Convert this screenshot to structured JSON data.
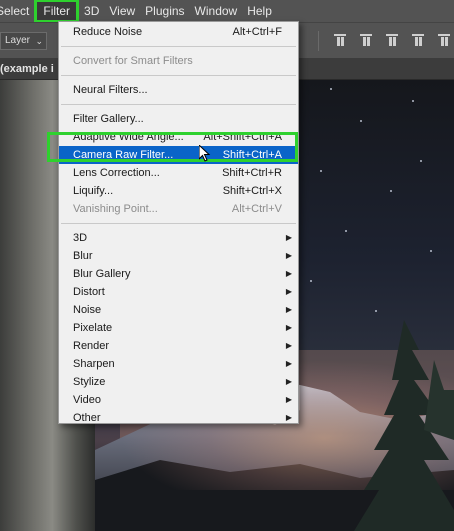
{
  "menubar": {
    "items": [
      "Select",
      "Filter",
      "3D",
      "View",
      "Plugins",
      "Window",
      "Help"
    ],
    "active": "Filter"
  },
  "options_bar": {
    "layer_dropdown": "Layer"
  },
  "document_tab": {
    "title": "(example i"
  },
  "filter_menu": {
    "items": [
      {
        "label": "Reduce Noise",
        "shortcut": "Alt+Ctrl+F"
      },
      {
        "label": "Convert for Smart Filters",
        "disabled": true
      },
      {
        "label": "Neural Filters..."
      },
      {
        "label": "Filter Gallery..."
      },
      {
        "label": "Adaptive Wide Angle...",
        "shortcut": "Alt+Shift+Ctrl+A"
      },
      {
        "label": "Camera Raw Filter...",
        "shortcut": "Shift+Ctrl+A",
        "highlighted": true
      },
      {
        "label": "Lens Correction...",
        "shortcut": "Shift+Ctrl+R"
      },
      {
        "label": "Liquify...",
        "shortcut": "Shift+Ctrl+X"
      },
      {
        "label": "Vanishing Point...",
        "shortcut": "Alt+Ctrl+V",
        "disabled": true
      },
      {
        "label": "3D",
        "submenu": true
      },
      {
        "label": "Blur",
        "submenu": true
      },
      {
        "label": "Blur Gallery",
        "submenu": true
      },
      {
        "label": "Distort",
        "submenu": true
      },
      {
        "label": "Noise",
        "submenu": true
      },
      {
        "label": "Pixelate",
        "submenu": true
      },
      {
        "label": "Render",
        "submenu": true
      },
      {
        "label": "Sharpen",
        "submenu": true
      },
      {
        "label": "Stylize",
        "submenu": true
      },
      {
        "label": "Video",
        "submenu": true
      },
      {
        "label": "Other",
        "submenu": true
      }
    ]
  },
  "colors": {
    "highlight_outline": "#2ed12e",
    "menu_highlight": "#0a64c8",
    "menu_background": "#f0f0f0",
    "menubar_background": "#535353"
  },
  "icons": {
    "submenu_arrow": "submenu-arrow-icon",
    "cursor": "mouse-pointer-icon",
    "dropdown_chevron": "chevron-down-icon"
  }
}
